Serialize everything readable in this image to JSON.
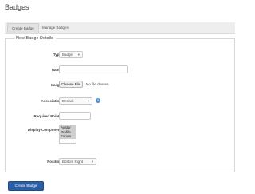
{
  "page": {
    "title": "Badges"
  },
  "tabs": [
    {
      "label": "Create Badge"
    },
    {
      "label": "Manage Badges"
    }
  ],
  "form": {
    "legend": "New Badge Details",
    "type": {
      "label": "Type",
      "value": "Badge"
    },
    "name": {
      "label": "Name",
      "value": ""
    },
    "image": {
      "label": "Image",
      "button": "Choose File",
      "status": "No file chosen"
    },
    "association": {
      "label": "Association",
      "value": "Denarit",
      "help_icon": "question-circle-icon"
    },
    "required_points": {
      "label": "Required Points",
      "value": ""
    },
    "display_component": {
      "label": "Display Component",
      "options": [
        "Avatar",
        "Profile",
        "Forum"
      ]
    },
    "position": {
      "label": "Position",
      "value": "Bottom Right"
    },
    "submit": {
      "label": "Create Badge"
    }
  },
  "colors": {
    "primary_button": "#2a5fa6",
    "help_icon": "#4a90d9"
  }
}
